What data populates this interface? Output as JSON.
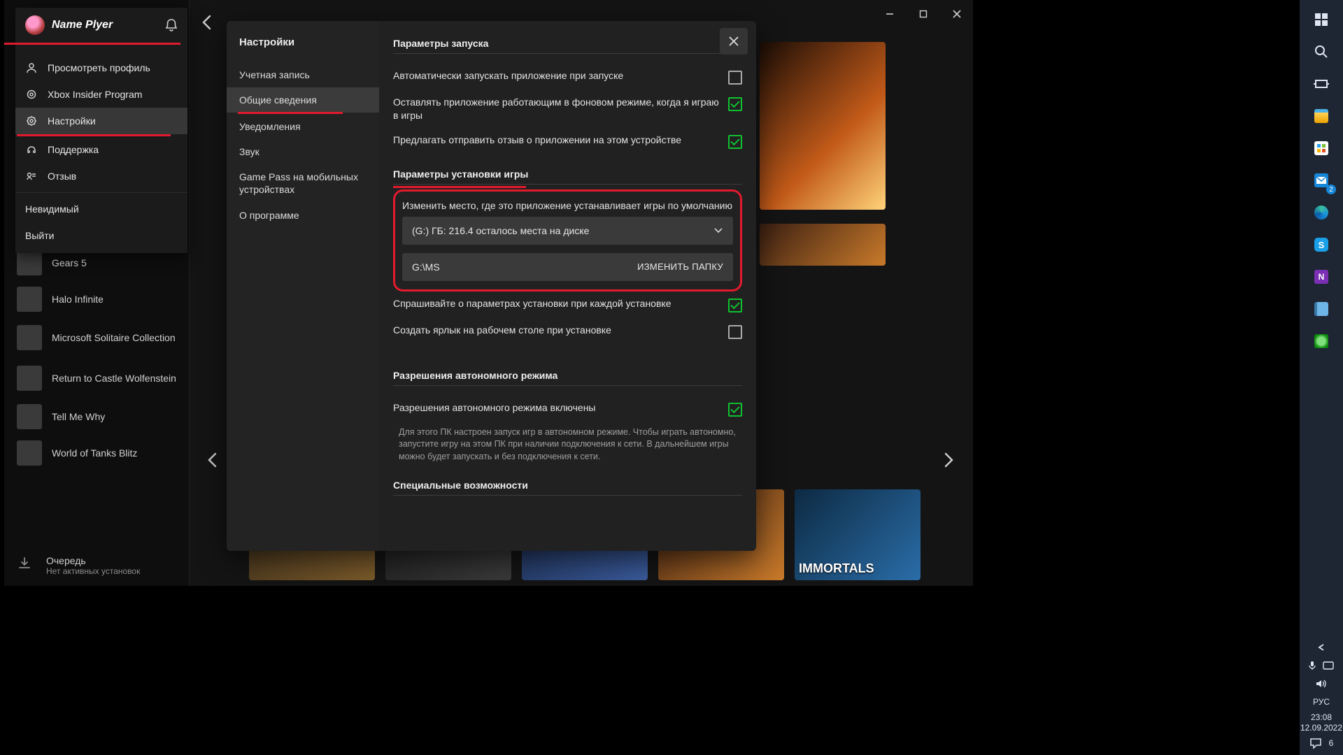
{
  "player": {
    "name": "Name Plyer"
  },
  "profile_menu": {
    "items": [
      {
        "icon": "person-icon",
        "label": "Просмотреть профиль"
      },
      {
        "icon": "ring-icon",
        "label": "Xbox Insider Program"
      },
      {
        "icon": "gear-icon",
        "label": "Настройки",
        "selected": true
      },
      {
        "icon": "headset-icon",
        "label": "Поддержка"
      },
      {
        "icon": "feedback-icon",
        "label": "Отзыв"
      }
    ],
    "status": "Невидимый",
    "signout": "Выйти"
  },
  "sidebar_games": [
    "Gears 5",
    "Halo Infinite",
    "Microsoft Solitaire Collection",
    "Return to Castle Wolfenstein",
    "Tell Me Why",
    "World of Tanks Blitz"
  ],
  "queue": {
    "title": "Очередь",
    "subtitle": "Нет активных установок"
  },
  "modal": {
    "title": "Настройки",
    "tabs": [
      "Учетная запись",
      "Общие сведения",
      "Уведомления",
      "Звук",
      "Game Pass на мобильных устройствах",
      "О программе"
    ],
    "selected_tab": 1,
    "sections": {
      "launch": {
        "title": "Параметры запуска",
        "opts": [
          {
            "label": "Автоматически запускать приложение при запуске",
            "checked": false
          },
          {
            "label": "Оставлять приложение работающим в фоновом режиме, когда я играю в игры",
            "checked": true
          },
          {
            "label": "Предлагать отправить отзыв о приложении на этом устройстве",
            "checked": true
          }
        ]
      },
      "install": {
        "title": "Параметры установки игры",
        "change_loc_label": "Изменить место, где это приложение устанавливает игры по умолчанию",
        "drive_display": "(G:) ГБ: 216.4 осталось места на диске",
        "path": "G:\\MS",
        "change_folder_btn": "ИЗМЕНИТЬ ПАПКУ",
        "opts": [
          {
            "label": "Спрашивайте о параметрах установки при каждой установке",
            "checked": true
          },
          {
            "label": "Создать ярлык на рабочем столе при установке",
            "checked": false
          }
        ]
      },
      "offline": {
        "title": "Разрешения автономного режима",
        "opt": {
          "label": "Разрешения автономного режима включены",
          "checked": true
        },
        "note": "Для этого ПК настроен запуск игр в автономном режиме. Чтобы играть автономно, запустите игру на этом ПК при наличии подключения к сети. В дальнейшем игры можно будет запускать и без подключения к сети."
      },
      "access": {
        "title": "Специальные возможности"
      }
    }
  },
  "carousel": {
    "immortals": "IMMORTALS"
  },
  "taskbar": {
    "lang": "РУС",
    "time": "23:08",
    "date": "12.09.2022",
    "mail_badge": "2",
    "note_badge": "",
    "action_badge": "6"
  }
}
